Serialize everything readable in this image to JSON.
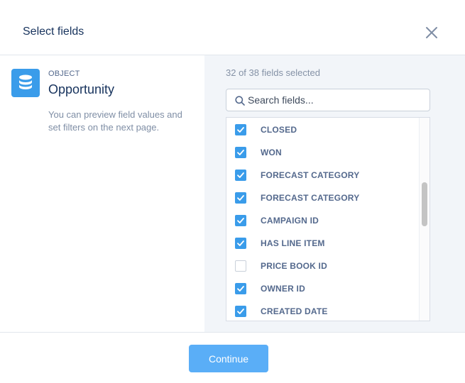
{
  "header": {
    "title": "Select fields",
    "close_icon": "close-icon"
  },
  "object": {
    "kicker": "OBJECT",
    "name": "Opportunity",
    "help": "You can preview field values and set filters on the next page.",
    "icon": "database-icon",
    "icon_color": "#3a9cea"
  },
  "fields_panel": {
    "count_text": "32 of 38 fields selected",
    "search_placeholder": "Search fields...",
    "items": [
      {
        "label": "CLOSED",
        "checked": true
      },
      {
        "label": "WON",
        "checked": true
      },
      {
        "label": "FORECAST CATEGORY",
        "checked": true
      },
      {
        "label": "FORECAST CATEGORY",
        "checked": true
      },
      {
        "label": "CAMPAIGN ID",
        "checked": true
      },
      {
        "label": "HAS LINE ITEM",
        "checked": true
      },
      {
        "label": "PRICE BOOK ID",
        "checked": false
      },
      {
        "label": "OWNER ID",
        "checked": true
      },
      {
        "label": "CREATED DATE",
        "checked": true
      }
    ]
  },
  "footer": {
    "continue_label": "Continue",
    "accent_color": "#5aaef7"
  }
}
